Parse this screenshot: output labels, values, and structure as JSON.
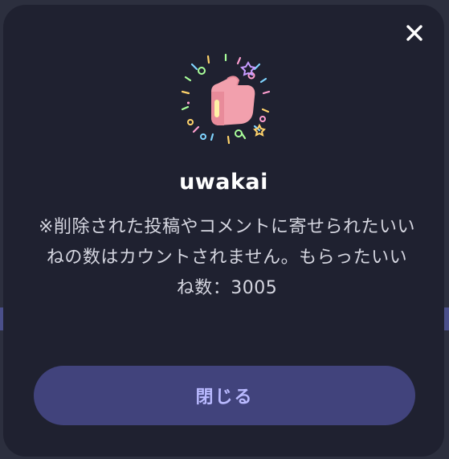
{
  "dialog": {
    "close_icon": "close-icon",
    "illustration_icon": "thumbs-up-celebration-icon",
    "username": "uwakai",
    "message": "※削除された投稿やコメントに寄せられたいいねの数はカウントされません。もらったいいね数：3005",
    "close_button_label": "閉じる"
  },
  "colors": {
    "dialog_background": "#1f2130",
    "button_background": "#41437c",
    "button_text": "#b9b9ff",
    "illustration_pink": "#f2a0ad"
  }
}
